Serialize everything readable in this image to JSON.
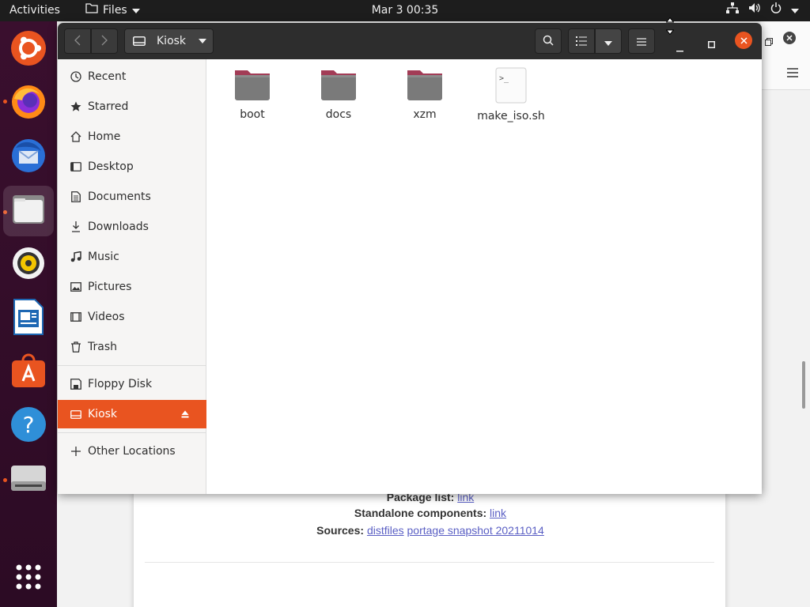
{
  "topbar": {
    "activities": "Activities",
    "app_menu": "Files",
    "clock": "Mar 3  00:35"
  },
  "dock": {
    "apps": [
      "ubuntu-logo",
      "firefox",
      "thunderbird",
      "files",
      "rhythmbox",
      "libreoffice-writer",
      "software-center",
      "help",
      "drive"
    ],
    "show_apps_icon": "grid-icon"
  },
  "window": {
    "location": "Kiosk",
    "sidebar": {
      "places": [
        {
          "label": "Recent",
          "icon": "clock-icon"
        },
        {
          "label": "Starred",
          "icon": "star-icon"
        },
        {
          "label": "Home",
          "icon": "home-icon"
        },
        {
          "label": "Desktop",
          "icon": "desktop-icon"
        },
        {
          "label": "Documents",
          "icon": "document-icon"
        },
        {
          "label": "Downloads",
          "icon": "download-icon"
        },
        {
          "label": "Music",
          "icon": "music-icon"
        },
        {
          "label": "Pictures",
          "icon": "picture-icon"
        },
        {
          "label": "Videos",
          "icon": "video-icon"
        },
        {
          "label": "Trash",
          "icon": "trash-icon"
        }
      ],
      "devices": [
        {
          "label": "Floppy Disk",
          "icon": "floppy-icon"
        },
        {
          "label": "Kiosk",
          "icon": "drive-icon",
          "selected": true
        }
      ],
      "other": {
        "label": "Other Locations",
        "icon": "plus-icon"
      }
    },
    "files": [
      {
        "name": "boot",
        "type": "folder"
      },
      {
        "name": "docs",
        "type": "folder"
      },
      {
        "name": "xzm",
        "type": "folder"
      },
      {
        "name": "make_iso.sh",
        "type": "script"
      }
    ]
  },
  "background_page": {
    "package_list_label": "Package list:",
    "package_list_link": "link",
    "standalone_label": "Standalone components:",
    "standalone_link": "link",
    "sources_label": "Sources:",
    "sources_link1": "distfiles",
    "sources_link2": "portage snapshot 20211014"
  },
  "colors": {
    "accent": "#e95420",
    "topbar": "#1d1d1d",
    "dock": "#2c0b24",
    "headerbar": "#2d2d2d"
  }
}
